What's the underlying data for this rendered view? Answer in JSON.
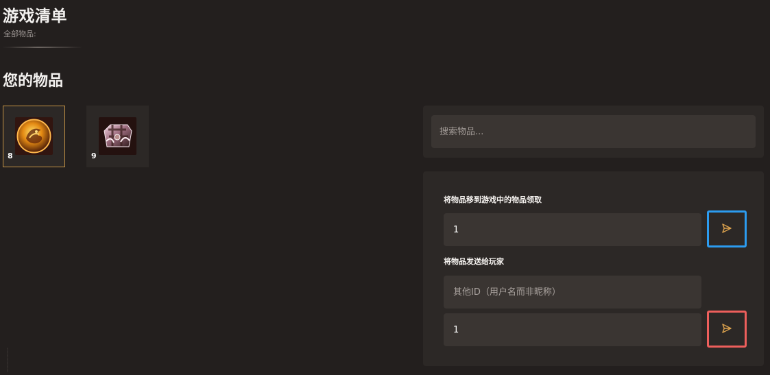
{
  "header": {
    "title": "游戏清单",
    "subtitle": "全部物品:"
  },
  "inventory": {
    "title": "您的物品",
    "items": [
      {
        "count": "8",
        "icon": "gold-dragon-medallion-icon",
        "selected": true
      },
      {
        "count": "9",
        "icon": "ornate-chest-icon",
        "selected": false
      }
    ]
  },
  "search": {
    "placeholder": "搜索物品..."
  },
  "transfer": {
    "move_label": "将物品移到游戏中的物品领取",
    "move_quantity": "1",
    "send_label": "将物品发送给玩家",
    "player_id_placeholder": "其他ID（用户名而非昵称）",
    "send_quantity": "1"
  },
  "colors": {
    "background": "#231f1e",
    "panel": "#2c2826",
    "input": "#3a3532",
    "selected_border": "#c79545",
    "blue_highlight": "#2c9cf0",
    "red_highlight": "#ee5f5c",
    "send_icon": "#d9a04d"
  }
}
